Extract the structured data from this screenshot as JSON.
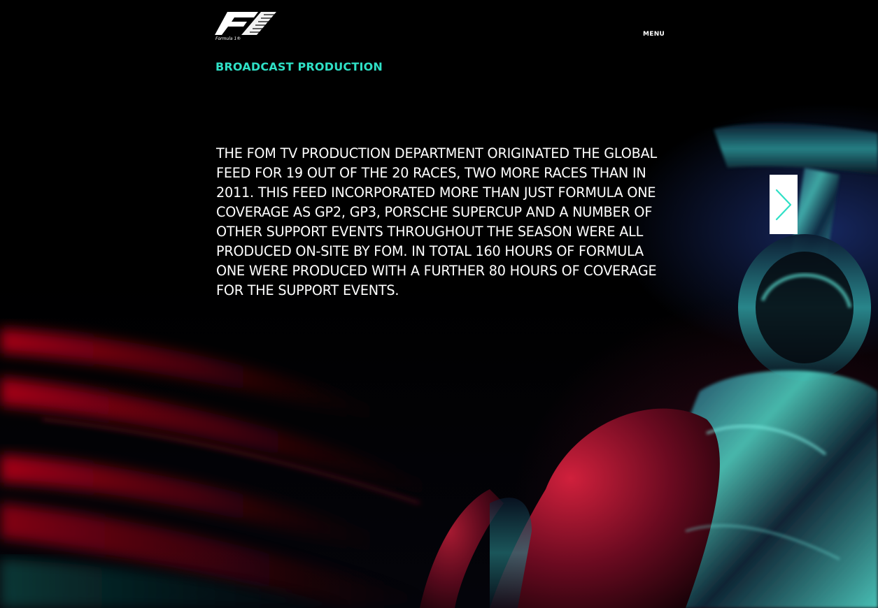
{
  "header": {
    "logo_alt": "Formula 1",
    "logo_tagline": "Formula 1®",
    "menu_label": "MENU"
  },
  "section": {
    "title": "BROADCAST PRODUCTION",
    "body": "THE FOM TV PRODUCTION DEPARTMENT ORIGINATED THE GLOBAL FEED FOR 19 OUT OF THE 20 RACES, TWO MORE RACES THAN IN 2011. THIS FEED INCORPORATED MORE THAN JUST FORMULA ONE COVERAGE AS GP2, GP3, PORSCHE SUPERCUP AND A NUMBER OF OTHER SUPPORT EVENTS THROUGHOUT THE SEASON WERE ALL PRODUCED ON-SITE BY FOM. IN TOTAL 160 HOURS OF FORMULA ONE WERE PRODUCED WITH A FURTHER 80 HOURS OF COVERAGE FOR THE SUPPORT EVENTS."
  },
  "navigation": {
    "next_icon": "chevron-right-icon"
  },
  "colors": {
    "accent": "#2fe0c6",
    "background": "#000000",
    "text": "#ffffff"
  }
}
